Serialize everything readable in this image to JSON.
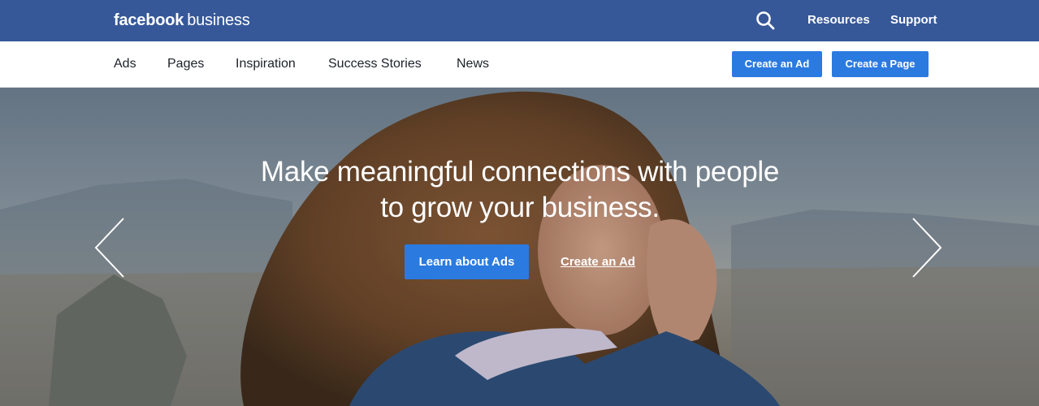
{
  "header": {
    "brand_bold": "facebook",
    "brand_light": "business",
    "search_icon": "search-icon",
    "links": [
      "Resources",
      "Support"
    ]
  },
  "nav": {
    "items": [
      "Ads",
      "Pages",
      "Inspiration",
      "Success Stories",
      "News"
    ],
    "create_ad": "Create an Ad",
    "create_page": "Create a Page"
  },
  "hero": {
    "headline_line1": "Make meaningful connections with people",
    "headline_line2": "to grow your business.",
    "primary_button": "Learn about Ads",
    "secondary_link": "Create an Ad",
    "prev_icon": "chevron-left-icon",
    "next_icon": "chevron-right-icon"
  },
  "colors": {
    "header_blue": "#365899",
    "button_blue": "#2b7ae0",
    "nav_text": "#1d2129"
  }
}
